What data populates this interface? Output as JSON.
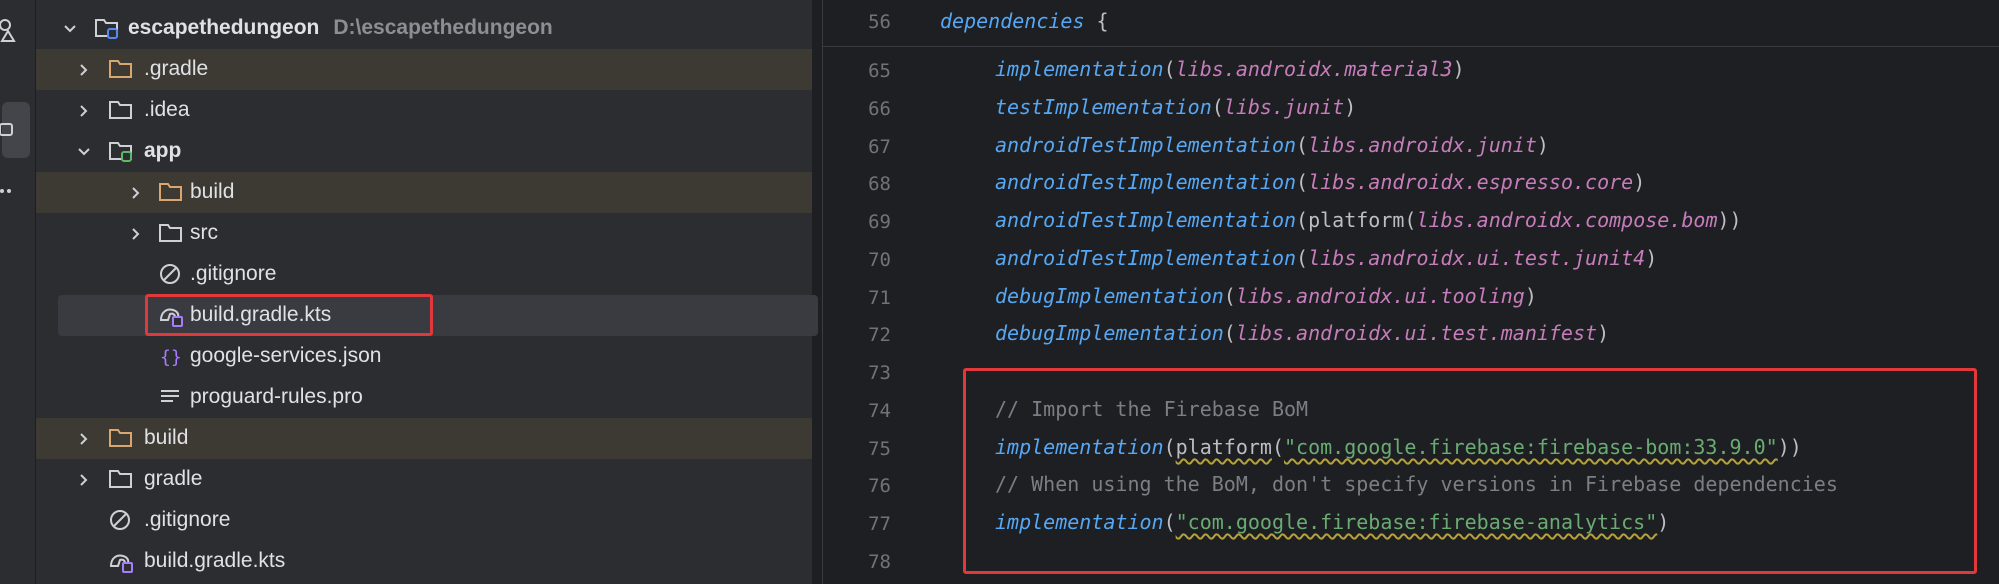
{
  "tool_strip": {
    "icons": [
      "shapes-icon",
      "project-icon",
      "more-icon"
    ]
  },
  "project_tree": {
    "items": [
      {
        "label": "escapethedungeon",
        "path": "D:\\escapethedungeon",
        "icon": "module-folder-icon",
        "expanded": true
      },
      {
        "label": ".gradle",
        "icon": "folder-icon",
        "excluded": true
      },
      {
        "label": ".idea",
        "icon": "folder-icon"
      },
      {
        "label": "app",
        "icon": "module-folder-icon",
        "expanded": true
      },
      {
        "label": "build",
        "icon": "folder-icon",
        "excluded": true
      },
      {
        "label": "src",
        "icon": "folder-icon"
      },
      {
        "label": ".gitignore",
        "icon": "ignore-icon"
      },
      {
        "label": "build.gradle.kts",
        "icon": "gradle-icon",
        "selected": true
      },
      {
        "label": "google-services.json",
        "icon": "json-icon"
      },
      {
        "label": "proguard-rules.pro",
        "icon": "text-file-icon"
      },
      {
        "label": "build",
        "icon": "folder-icon",
        "excluded": true
      },
      {
        "label": "gradle",
        "icon": "folder-icon"
      },
      {
        "label": ".gitignore",
        "icon": "ignore-icon"
      },
      {
        "label": "build.gradle.kts",
        "icon": "gradle-icon"
      }
    ]
  },
  "editor": {
    "sticky": {
      "line": "56",
      "keyword": "dependencies",
      "brace": " {"
    },
    "lines": [
      {
        "num": "65",
        "fn": "implementation",
        "open": "(",
        "arg": "libs.androidx.material3",
        "close": ")"
      },
      {
        "num": "66",
        "fn": "testImplementation",
        "open": "(",
        "arg": "libs.junit",
        "close": ")"
      },
      {
        "num": "67",
        "fn": "androidTestImplementation",
        "open": "(",
        "arg": "libs.androidx.junit",
        "close": ")"
      },
      {
        "num": "68",
        "fn": "androidTestImplementation",
        "open": "(",
        "arg": "libs.androidx.espresso.core",
        "close": ")"
      },
      {
        "num": "69",
        "fn": "androidTestImplementation",
        "open": "(platform(",
        "arg": "libs.androidx.compose.bom",
        "close": "))"
      },
      {
        "num": "70",
        "fn": "androidTestImplementation",
        "open": "(",
        "arg": "libs.androidx.ui.test.junit4",
        "close": ")"
      },
      {
        "num": "71",
        "fn": "debugImplementation",
        "open": "(",
        "arg": "libs.androidx.ui.tooling",
        "close": ")"
      },
      {
        "num": "72",
        "fn": "debugImplementation",
        "open": "(",
        "arg": "libs.androidx.ui.test.manifest",
        "close": ")"
      }
    ],
    "line73": "73",
    "line74": {
      "num": "74",
      "comment": "// Import the Firebase BoM"
    },
    "line75": {
      "num": "75",
      "fn": "implementation",
      "open": "(",
      "platform": "platform",
      "open2": "(",
      "str": "\"com.google.firebase:firebase-bom:33.9.0\"",
      "close": "))"
    },
    "line76": {
      "num": "76",
      "comment": "// When using the BoM, don't specify versions in Firebase dependencies"
    },
    "line77": {
      "num": "77",
      "fn": "implementation",
      "open": "(",
      "str": "\"com.google.firebase:firebase-analytics\"",
      "close": ")"
    },
    "line78": "78"
  },
  "colors": {
    "background": "#1e1f22",
    "panel": "#2b2d30",
    "keyword": "#56a8f5",
    "library": "#c77dbb",
    "string": "#6aab73",
    "comment": "#7a7e85",
    "highlight": "#e0383b"
  }
}
